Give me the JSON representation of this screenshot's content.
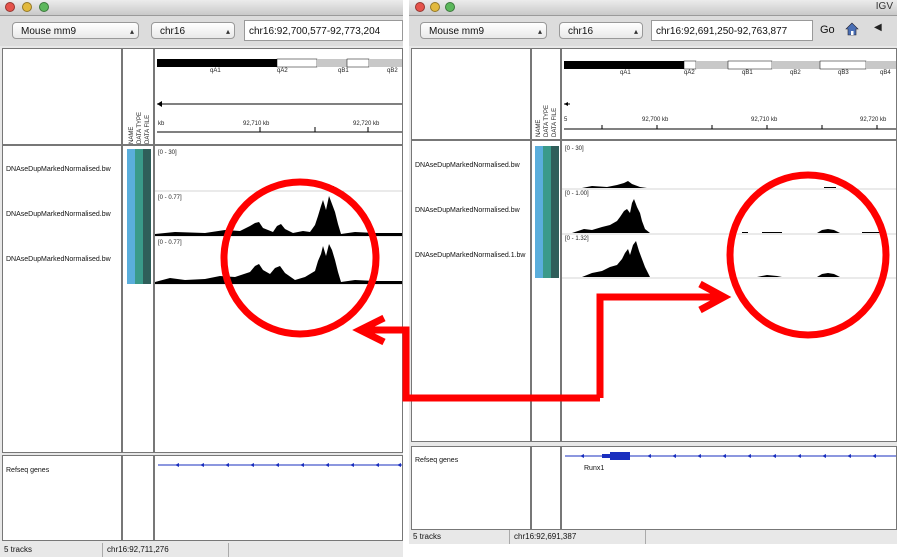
{
  "left_window": {
    "genome": "Mouse mm9",
    "chromosome": "chr16",
    "locus": "chr16:92,700,577-92,773,204",
    "cytobands": [
      "qA1",
      "qA2",
      "qB1",
      "qB2"
    ],
    "ruler": {
      "unit_label": "kb",
      "ticks": [
        "92,710 kb",
        "92,720 kb"
      ]
    },
    "attribute_headers": [
      "NAME",
      "DATA TYPE",
      "DATA FILE"
    ],
    "tracks": [
      {
        "name": "DNAseDupMarkedNormalised.bw",
        "range": "[0 - 30]"
      },
      {
        "name": "DNAseDupMarkedNormalised.bw",
        "range": "[0 - 0.77]"
      },
      {
        "name": "DNAseDupMarkedNormalised.bw",
        "range": "[0 - 0.77]"
      }
    ],
    "gene_track": {
      "name": "Refseq genes"
    },
    "status": {
      "tracks": "5 tracks",
      "position": "chr16:92,711,276"
    }
  },
  "right_window": {
    "window_title": "IGV",
    "genome": "Mouse mm9",
    "chromosome": "chr16",
    "locus": "chr16:92,691,250-92,763,877",
    "go_label": "Go",
    "cytobands": [
      "qA1",
      "qA2",
      "qB1",
      "qB2",
      "qB3",
      "qB4"
    ],
    "ruler": {
      "ticks": [
        "5",
        "92,700 kb",
        "92,710 kb",
        "92,720 kb"
      ]
    },
    "attribute_headers": [
      "NAME",
      "DATA TYPE",
      "DATA FILE"
    ],
    "tracks": [
      {
        "name": "DNAseDupMarkedNormalised.bw",
        "range": "[0 - 30]"
      },
      {
        "name": "DNAseDupMarkedNormalised.bw",
        "range": "[0 - 1.00]"
      },
      {
        "name": "DNAseDupMarkedNormalised.1.bw",
        "range": "[0 - 1.32]"
      }
    ],
    "gene_track": {
      "name": "Refseq genes",
      "gene": "Runx1"
    },
    "status": {
      "tracks": "5 tracks",
      "position": "chr16:92,691,387"
    }
  },
  "colors": {
    "annotation": "#ff0000",
    "attr_name": "#5aaedc",
    "attr_type": "#3a9a8a",
    "attr_file": "#2f5e5a",
    "gene": "#1a2fbf"
  },
  "icons": [
    "close-icon",
    "minimize-icon",
    "zoom-icon",
    "home-icon",
    "back-arrow-icon",
    "dropdown-arrow-icon"
  ]
}
